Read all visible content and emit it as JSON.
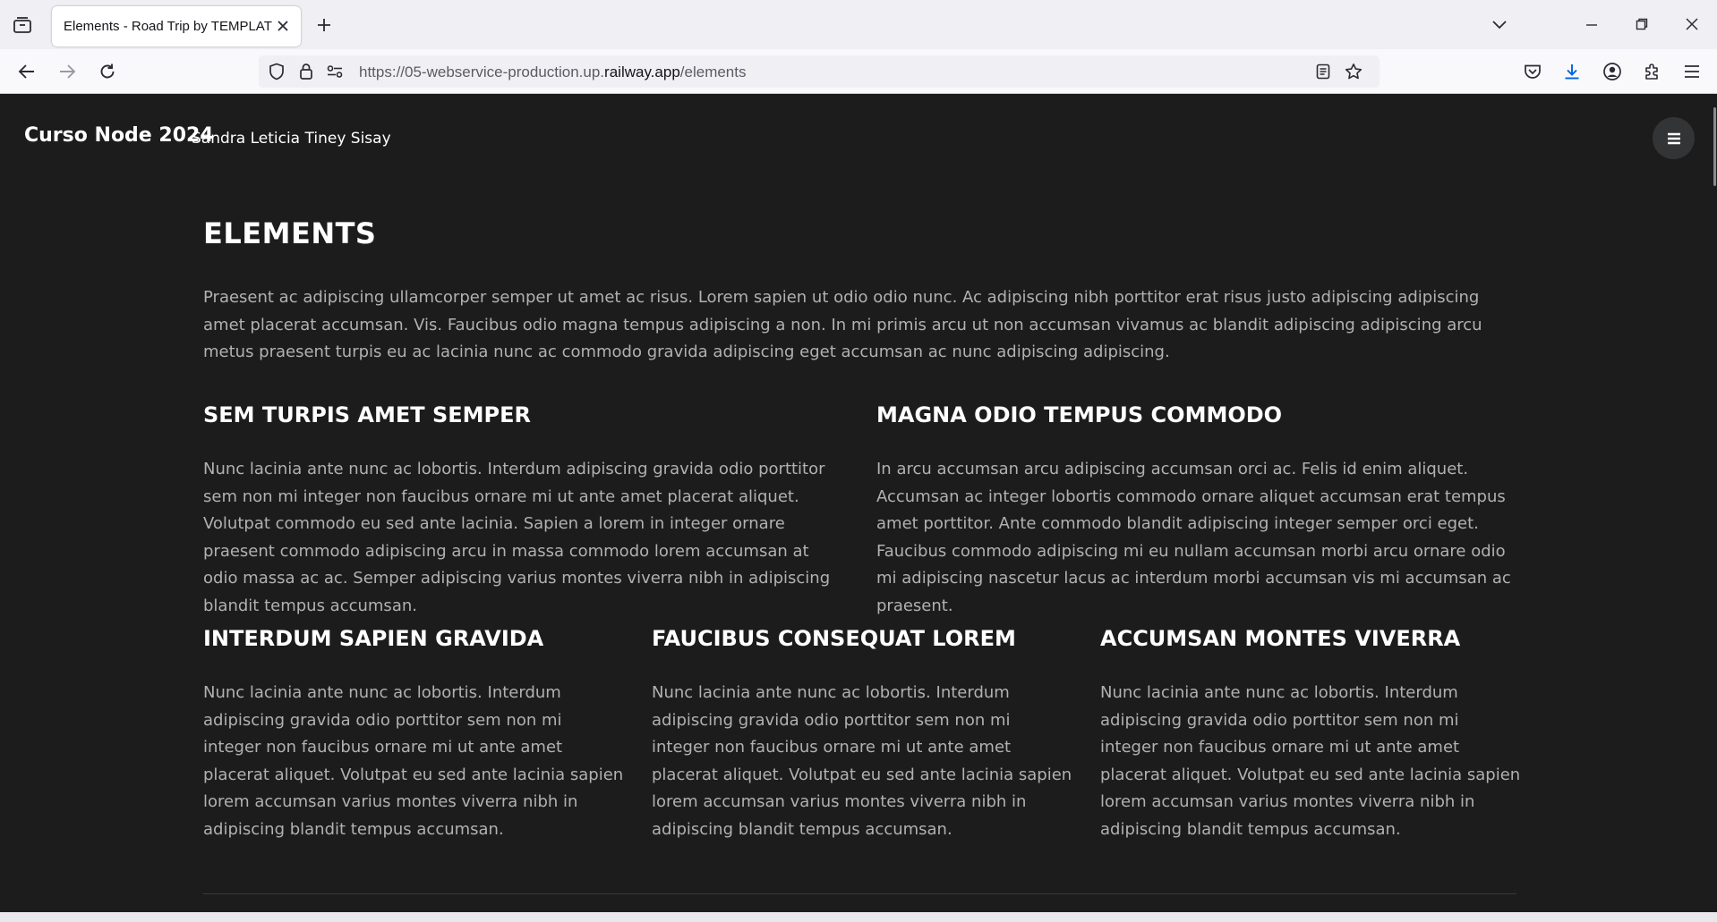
{
  "browser": {
    "tab_title": "Elements - Road Trip by TEMPLATE",
    "url_prefix": "https://05-webservice-production.up.",
    "url_domain": "railway.app",
    "url_path": "/elements"
  },
  "site": {
    "brand": "Curso Node 2024",
    "author": "Sandra Leticia Tiney Sisay"
  },
  "main": {
    "title": "ELEMENTS",
    "intro": "Praesent ac adipiscing ullamcorper semper ut amet ac risus. Lorem sapien ut odio odio nunc. Ac adipiscing nibh porttitor erat risus justo adipiscing adipiscing amet placerat accumsan. Vis. Faucibus odio magna tempus adipiscing a non. In mi primis arcu ut non accumsan vivamus ac blandit adipiscing adipiscing arcu metus praesent turpis eu ac lacinia nunc ac commodo gravida adipiscing eget accumsan ac nunc adipiscing adipiscing.",
    "two_col": [
      {
        "heading": "SEM TURPIS AMET SEMPER",
        "text": "Nunc lacinia ante nunc ac lobortis. Interdum adipiscing gravida odio porttitor sem non mi integer non faucibus ornare mi ut ante amet placerat aliquet. Volutpat commodo eu sed ante lacinia. Sapien a lorem in integer ornare praesent commodo adipiscing arcu in massa commodo lorem accumsan at odio massa ac ac. Semper adipiscing varius montes viverra nibh in adipiscing blandit tempus accumsan."
      },
      {
        "heading": "MAGNA ODIO TEMPUS COMMODO",
        "text": "In arcu accumsan arcu adipiscing accumsan orci ac. Felis id enim aliquet. Accumsan ac integer lobortis commodo ornare aliquet accumsan erat tempus amet porttitor. Ante commodo blandit adipiscing integer semper orci eget. Faucibus commodo adipiscing mi eu nullam accumsan morbi arcu ornare odio mi adipiscing nascetur lacus ac interdum morbi accumsan vis mi accumsan ac praesent."
      }
    ],
    "three_col": [
      {
        "heading": "INTERDUM SAPIEN GRAVIDA",
        "text": "Nunc lacinia ante nunc ac lobortis. Interdum adipiscing gravida odio porttitor sem non mi integer non faucibus ornare mi ut ante amet placerat aliquet. Volutpat eu sed ante lacinia sapien lorem accumsan varius montes viverra nibh in adipiscing blandit tempus accumsan."
      },
      {
        "heading": "FAUCIBUS CONSEQUAT LOREM",
        "text": "Nunc lacinia ante nunc ac lobortis. Interdum adipiscing gravida odio porttitor sem non mi integer non faucibus ornare mi ut ante amet placerat aliquet. Volutpat eu sed ante lacinia sapien lorem accumsan varius montes viverra nibh in adipiscing blandit tempus accumsan."
      },
      {
        "heading": "ACCUMSAN MONTES VIVERRA",
        "text": "Nunc lacinia ante nunc ac lobortis. Interdum adipiscing gravida odio porttitor sem non mi integer non faucibus ornare mi ut ante amet placerat aliquet. Volutpat eu sed ante lacinia sapien lorem accumsan varius montes viverra nibh in adipiscing blandit tempus accumsan."
      }
    ]
  },
  "colors": {
    "page_bg": "#1c1c1c",
    "heading": "#ffffff",
    "body_text": "#b1b1b1",
    "chrome_bg": "#efeff4"
  },
  "icons": [
    "tab-list-icon",
    "close-icon",
    "plus-icon",
    "chevron-down-icon",
    "minimize-icon",
    "restore-icon",
    "back-icon",
    "forward-icon",
    "reload-icon",
    "shield-icon",
    "lock-icon",
    "permissions-icon",
    "reader-view-icon",
    "star-icon",
    "pocket-icon",
    "download-icon",
    "account-icon",
    "extensions-icon",
    "app-menu-icon",
    "hamburger-icon"
  ]
}
